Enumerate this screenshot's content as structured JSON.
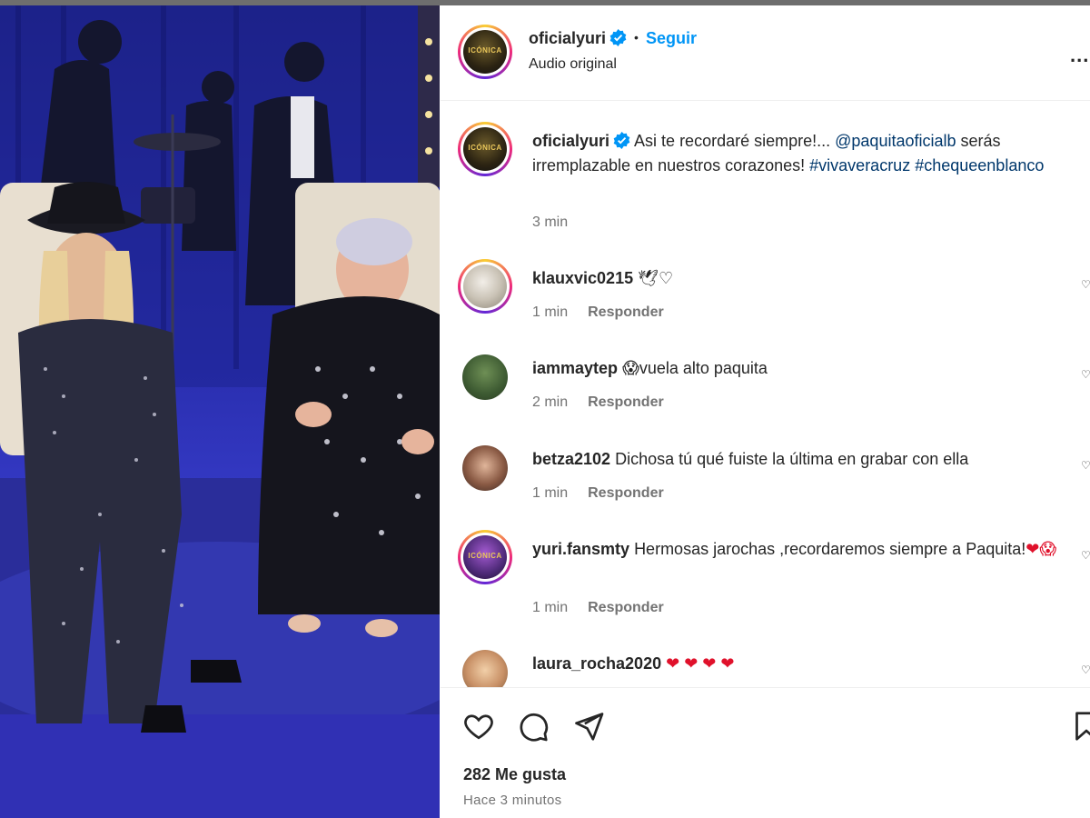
{
  "header": {
    "username": "oficialyuri",
    "avatar_text": "ICÓNICA",
    "dot": "•",
    "follow_label": "Seguir",
    "audio_label": "Audio original",
    "more_label": "..."
  },
  "caption": {
    "username": "oficialyuri",
    "text_start": "Asi te recordaré siempre!... ",
    "mention": "@paquitaoficialb",
    "text_mid": " serás irremplazable en nuestros corazones! ",
    "tag1": "#vivaveracruz",
    "tag2": "#chequeenblanco",
    "time": "3 min"
  },
  "comments": [
    {
      "username": "klauxvic0215",
      "text": "🕊♡",
      "time": "1 min",
      "reply": "Responder"
    },
    {
      "username": "iammaytep",
      "text": "😱vuela alto paquita",
      "time": "2 min",
      "reply": "Responder"
    },
    {
      "username": "betza2102",
      "text": "Dichosa tú qué fuiste la última en grabar con ella",
      "time": "1 min",
      "reply": "Responder"
    },
    {
      "username": "yuri.fansmty",
      "text": "Hermosas jarochas ,recordaremos siempre a Paquita!",
      "text_emoji": "❤😱",
      "time": "1 min",
      "reply": "Responder"
    },
    {
      "username": "laura_rocha2020",
      "text": "❤ ❤ ❤ ❤"
    }
  ],
  "footer": {
    "likes": "282 Me gusta",
    "time": "Hace 3 minutos"
  },
  "icons": [
    "heart-icon",
    "comment-icon",
    "share-icon",
    "bookmark-icon",
    "verified-icon",
    "more-icon"
  ],
  "colors": {
    "accent": "#0095f6",
    "text": "#262626",
    "muted": "#737373",
    "heart": "#e0112b"
  }
}
